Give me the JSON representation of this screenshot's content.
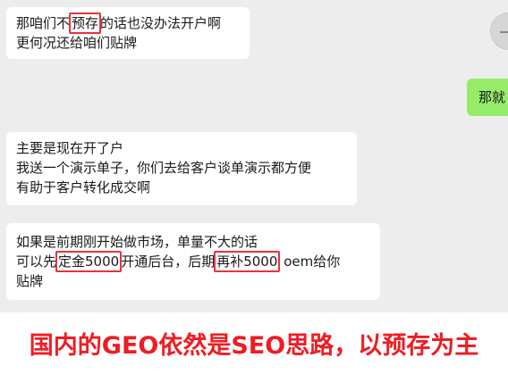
{
  "messages": [
    {
      "lines": [
        {
          "pre": "那咱们不",
          "hl": "预存",
          "post": "的话也没办法开户啊"
        },
        {
          "text": "更何况还给咱们贴牌"
        }
      ]
    },
    {
      "text": "那就"
    },
    {
      "lines": [
        {
          "text": "主要是现在开了户"
        },
        {
          "text": "我送一个演示单子，你们去给客户谈单演示都方便"
        },
        {
          "text": "有助于客户转化成交啊"
        }
      ]
    },
    {
      "lines": [
        {
          "text": "如果是前期刚开始做市场，单量不大的话"
        },
        {
          "pre": "可以先",
          "hl": "定金5000",
          "mid": "开通后台，后期",
          "hl2": "再补5000",
          "post": "oem给你"
        },
        {
          "text": "贴牌"
        }
      ]
    }
  ],
  "caption": "国内的GEO依然是SEO思路，以预存为主",
  "colors": {
    "background": "#ededed",
    "incoming_bubble": "#ffffff",
    "outgoing_bubble": "#95ec69",
    "highlight_box": "#e8323c",
    "caption": "#ee1d23"
  }
}
